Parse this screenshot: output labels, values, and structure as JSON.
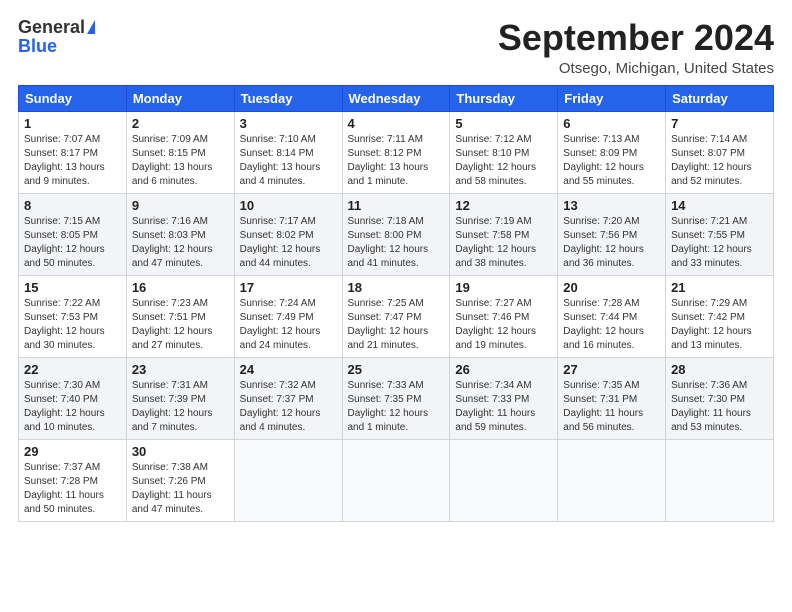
{
  "header": {
    "logo_general": "General",
    "logo_blue": "Blue",
    "month_title": "September 2024",
    "location": "Otsego, Michigan, United States"
  },
  "weekdays": [
    "Sunday",
    "Monday",
    "Tuesday",
    "Wednesday",
    "Thursday",
    "Friday",
    "Saturday"
  ],
  "weeks": [
    [
      {
        "day": "1",
        "info": "Sunrise: 7:07 AM\nSunset: 8:17 PM\nDaylight: 13 hours\nand 9 minutes."
      },
      {
        "day": "2",
        "info": "Sunrise: 7:09 AM\nSunset: 8:15 PM\nDaylight: 13 hours\nand 6 minutes."
      },
      {
        "day": "3",
        "info": "Sunrise: 7:10 AM\nSunset: 8:14 PM\nDaylight: 13 hours\nand 4 minutes."
      },
      {
        "day": "4",
        "info": "Sunrise: 7:11 AM\nSunset: 8:12 PM\nDaylight: 13 hours\nand 1 minute."
      },
      {
        "day": "5",
        "info": "Sunrise: 7:12 AM\nSunset: 8:10 PM\nDaylight: 12 hours\nand 58 minutes."
      },
      {
        "day": "6",
        "info": "Sunrise: 7:13 AM\nSunset: 8:09 PM\nDaylight: 12 hours\nand 55 minutes."
      },
      {
        "day": "7",
        "info": "Sunrise: 7:14 AM\nSunset: 8:07 PM\nDaylight: 12 hours\nand 52 minutes."
      }
    ],
    [
      {
        "day": "8",
        "info": "Sunrise: 7:15 AM\nSunset: 8:05 PM\nDaylight: 12 hours\nand 50 minutes."
      },
      {
        "day": "9",
        "info": "Sunrise: 7:16 AM\nSunset: 8:03 PM\nDaylight: 12 hours\nand 47 minutes."
      },
      {
        "day": "10",
        "info": "Sunrise: 7:17 AM\nSunset: 8:02 PM\nDaylight: 12 hours\nand 44 minutes."
      },
      {
        "day": "11",
        "info": "Sunrise: 7:18 AM\nSunset: 8:00 PM\nDaylight: 12 hours\nand 41 minutes."
      },
      {
        "day": "12",
        "info": "Sunrise: 7:19 AM\nSunset: 7:58 PM\nDaylight: 12 hours\nand 38 minutes."
      },
      {
        "day": "13",
        "info": "Sunrise: 7:20 AM\nSunset: 7:56 PM\nDaylight: 12 hours\nand 36 minutes."
      },
      {
        "day": "14",
        "info": "Sunrise: 7:21 AM\nSunset: 7:55 PM\nDaylight: 12 hours\nand 33 minutes."
      }
    ],
    [
      {
        "day": "15",
        "info": "Sunrise: 7:22 AM\nSunset: 7:53 PM\nDaylight: 12 hours\nand 30 minutes."
      },
      {
        "day": "16",
        "info": "Sunrise: 7:23 AM\nSunset: 7:51 PM\nDaylight: 12 hours\nand 27 minutes."
      },
      {
        "day": "17",
        "info": "Sunrise: 7:24 AM\nSunset: 7:49 PM\nDaylight: 12 hours\nand 24 minutes."
      },
      {
        "day": "18",
        "info": "Sunrise: 7:25 AM\nSunset: 7:47 PM\nDaylight: 12 hours\nand 21 minutes."
      },
      {
        "day": "19",
        "info": "Sunrise: 7:27 AM\nSunset: 7:46 PM\nDaylight: 12 hours\nand 19 minutes."
      },
      {
        "day": "20",
        "info": "Sunrise: 7:28 AM\nSunset: 7:44 PM\nDaylight: 12 hours\nand 16 minutes."
      },
      {
        "day": "21",
        "info": "Sunrise: 7:29 AM\nSunset: 7:42 PM\nDaylight: 12 hours\nand 13 minutes."
      }
    ],
    [
      {
        "day": "22",
        "info": "Sunrise: 7:30 AM\nSunset: 7:40 PM\nDaylight: 12 hours\nand 10 minutes."
      },
      {
        "day": "23",
        "info": "Sunrise: 7:31 AM\nSunset: 7:39 PM\nDaylight: 12 hours\nand 7 minutes."
      },
      {
        "day": "24",
        "info": "Sunrise: 7:32 AM\nSunset: 7:37 PM\nDaylight: 12 hours\nand 4 minutes."
      },
      {
        "day": "25",
        "info": "Sunrise: 7:33 AM\nSunset: 7:35 PM\nDaylight: 12 hours\nand 1 minute."
      },
      {
        "day": "26",
        "info": "Sunrise: 7:34 AM\nSunset: 7:33 PM\nDaylight: 11 hours\nand 59 minutes."
      },
      {
        "day": "27",
        "info": "Sunrise: 7:35 AM\nSunset: 7:31 PM\nDaylight: 11 hours\nand 56 minutes."
      },
      {
        "day": "28",
        "info": "Sunrise: 7:36 AM\nSunset: 7:30 PM\nDaylight: 11 hours\nand 53 minutes."
      }
    ],
    [
      {
        "day": "29",
        "info": "Sunrise: 7:37 AM\nSunset: 7:28 PM\nDaylight: 11 hours\nand 50 minutes."
      },
      {
        "day": "30",
        "info": "Sunrise: 7:38 AM\nSunset: 7:26 PM\nDaylight: 11 hours\nand 47 minutes."
      },
      {
        "day": "",
        "info": ""
      },
      {
        "day": "",
        "info": ""
      },
      {
        "day": "",
        "info": ""
      },
      {
        "day": "",
        "info": ""
      },
      {
        "day": "",
        "info": ""
      }
    ]
  ]
}
